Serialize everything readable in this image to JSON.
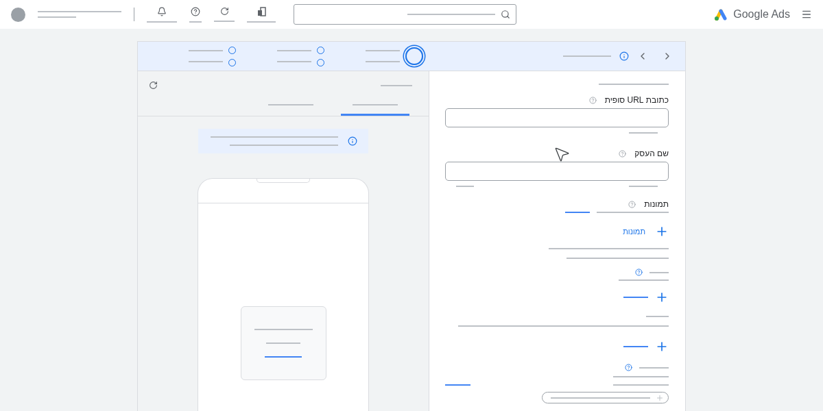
{
  "app": {
    "brand": "Google Ads"
  },
  "steps": [
    {
      "selected": false
    },
    {
      "selected": false
    },
    {
      "selected": true
    }
  ],
  "preview": {
    "tabs": [
      {
        "selected": false
      },
      {
        "selected": true
      }
    ]
  },
  "form": {
    "fields": [
      {
        "label": "כתובת URL סופית"
      },
      {
        "label": "שם העסק"
      }
    ],
    "images": {
      "label": "תמונות",
      "add_link": "תמונות"
    }
  }
}
